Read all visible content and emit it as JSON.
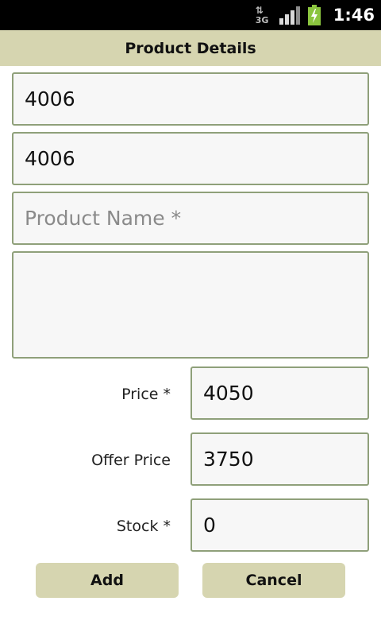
{
  "status_bar": {
    "network_type": "3G",
    "time": "1:46",
    "signal_icon": "signal-bars-icon",
    "battery_icon": "battery-charging-icon",
    "network_icon": "network-3g-icon"
  },
  "header": {
    "title": "Product Details"
  },
  "form": {
    "product_code_1": {
      "value": "4006"
    },
    "product_code_2": {
      "value": "4006"
    },
    "product_name": {
      "value": "",
      "placeholder": "Product Name *"
    },
    "description": {
      "value": ""
    },
    "price": {
      "label": "Price *",
      "value": "4050"
    },
    "offer_price": {
      "label": "Offer Price",
      "value": "3750"
    },
    "stock": {
      "label": "Stock *",
      "value": "0"
    }
  },
  "actions": {
    "add_label": "Add",
    "cancel_label": "Cancel"
  },
  "colors": {
    "accent": "#d6d5b0",
    "field_border": "#8fa07a",
    "battery_green": "#8bc53f"
  }
}
